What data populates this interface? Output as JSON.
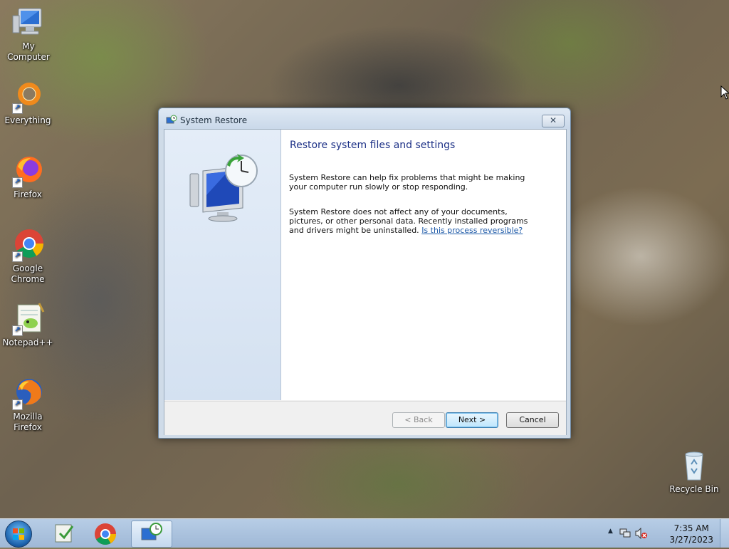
{
  "desktop": {
    "icons": [
      {
        "label": "My Computer"
      },
      {
        "label": "Everything"
      },
      {
        "label": "Firefox"
      },
      {
        "label": "Google Chrome"
      },
      {
        "label": "Notepad++"
      },
      {
        "label": "Mozilla Firefox"
      },
      {
        "label": "Recycle Bin"
      }
    ]
  },
  "window": {
    "title": "System Restore",
    "close_label": "✕",
    "heading": "Restore system files and settings",
    "para1": "System Restore can help fix problems that might be making your computer run slowly or stop responding.",
    "para2": "System Restore does not affect any of your documents, pictures, or other personal data. Recently installed programs and drivers might be uninstalled.",
    "link": "Is this process reversible?",
    "buttons": {
      "back": "< Back",
      "next": "Next >",
      "cancel": "Cancel"
    }
  },
  "taskbar": {
    "clock_time": "7:35 AM",
    "clock_date": "3/27/2023",
    "tray_expand": "▲"
  }
}
